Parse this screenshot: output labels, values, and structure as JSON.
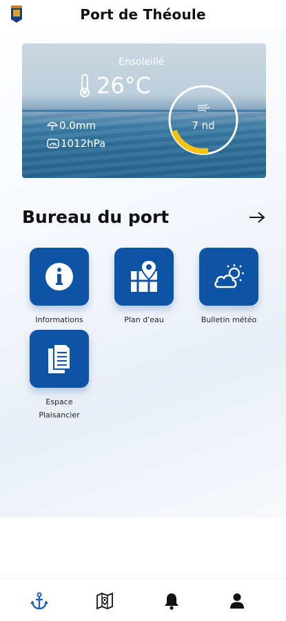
{
  "header": {
    "title": "Port de Théoule",
    "logo_icon": "port-crest-icon"
  },
  "weather": {
    "condition": "Ensoleillé",
    "temperature": "26°C",
    "rain": "0.0mm",
    "pressure": "1012hPa",
    "wind": "7 nd",
    "wind_gauge_fraction": 0.22,
    "gauge_color": "#f5c211",
    "icons": [
      "thermometer-icon",
      "umbrella-icon",
      "gauge-icon",
      "wind-icon"
    ]
  },
  "section": {
    "title": "Bureau du port",
    "arrow_icon": "arrow-right-icon"
  },
  "tiles": [
    {
      "label": "Informations",
      "icon": "info-icon"
    },
    {
      "label": "Plan d'eau",
      "icon": "map-pin-icon"
    },
    {
      "label": "Bulletin météo",
      "icon": "cloud-sun-icon"
    },
    {
      "label_line1": "Espace",
      "label_line2": "Plaisancier",
      "icon": "documents-icon"
    }
  ],
  "bottom_nav": [
    {
      "icon": "anchor-icon",
      "active": true
    },
    {
      "icon": "map-icon",
      "active": false
    },
    {
      "icon": "bell-icon",
      "active": false
    },
    {
      "icon": "user-icon",
      "active": false
    }
  ],
  "colors": {
    "accent": "#0d54a5",
    "active_nav": "#1f5fb0",
    "inactive_nav": "#111111"
  }
}
